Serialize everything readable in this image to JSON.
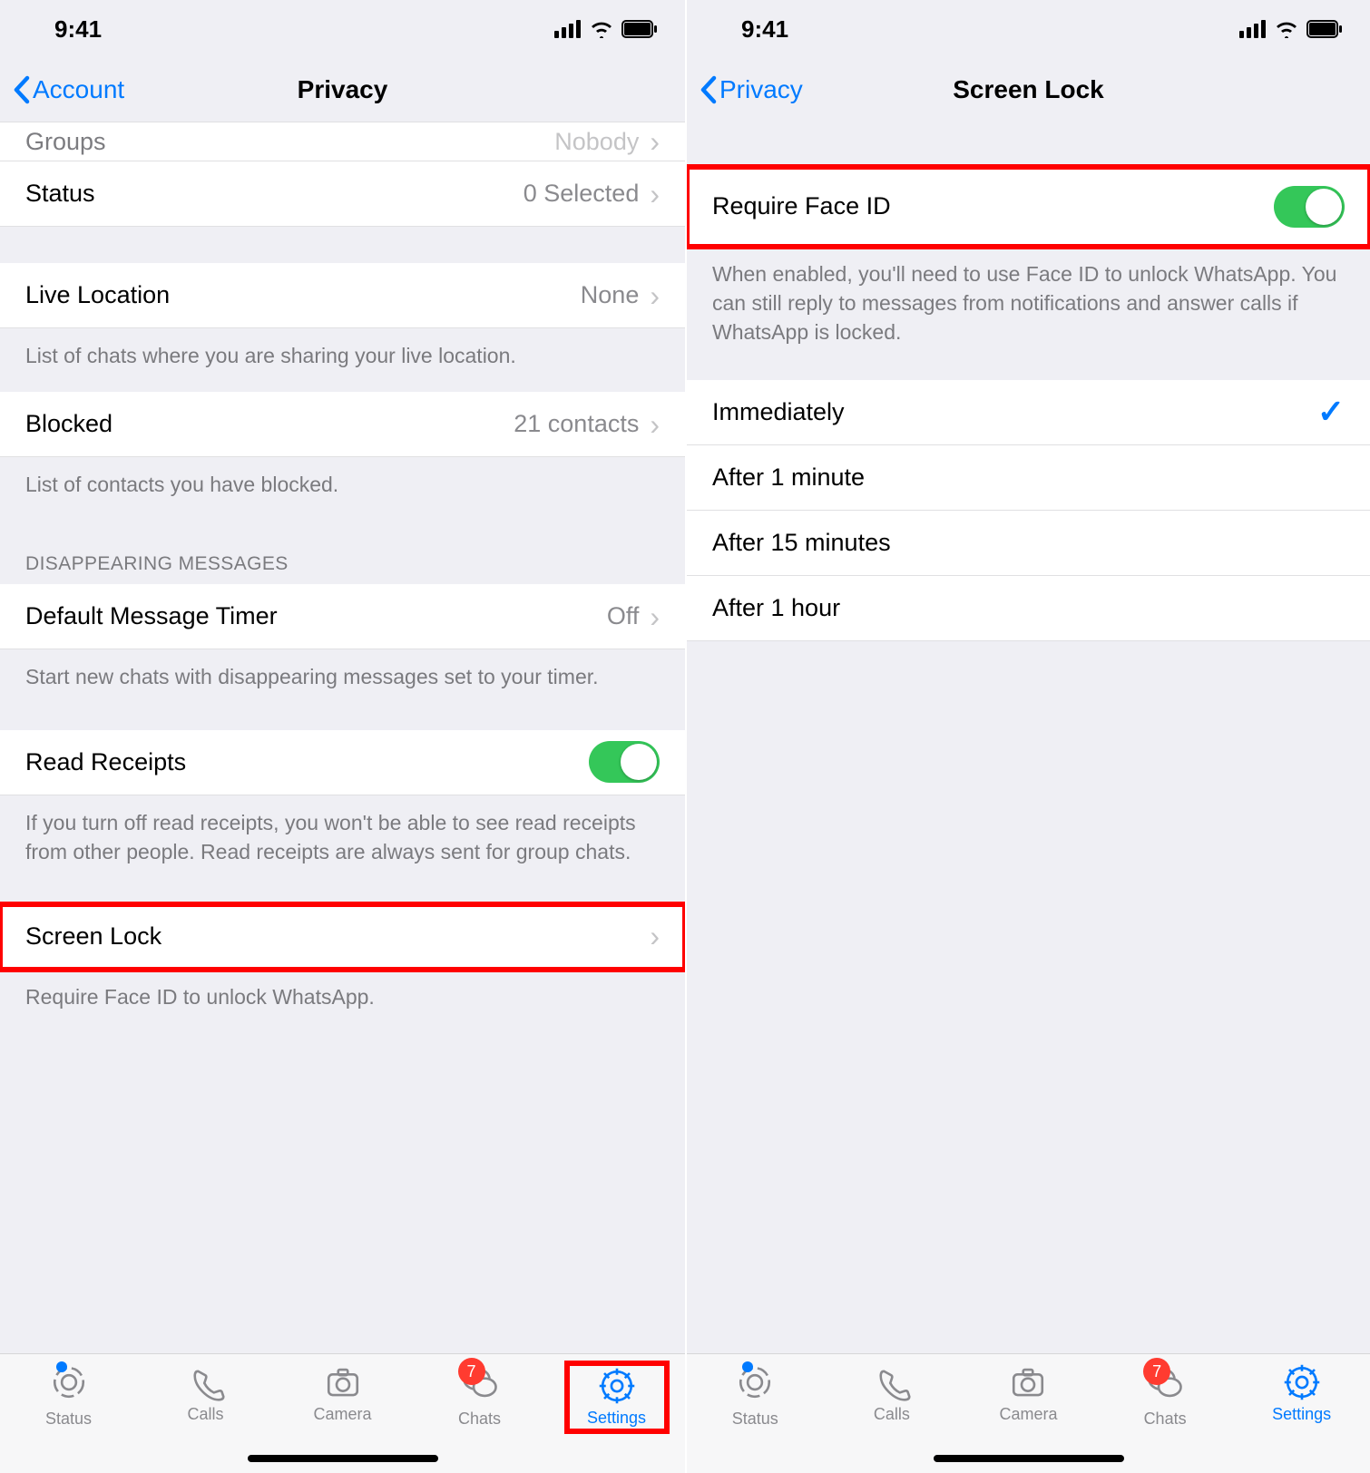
{
  "left": {
    "status_time": "9:41",
    "back_label": "Account",
    "title": "Privacy",
    "rows": {
      "groups": {
        "label": "Groups",
        "value": "Nobody"
      },
      "status": {
        "label": "Status",
        "value": "0 Selected"
      },
      "live_location": {
        "label": "Live Location",
        "value": "None"
      },
      "blocked": {
        "label": "Blocked",
        "value": "21 contacts"
      },
      "default_timer": {
        "label": "Default Message Timer",
        "value": "Off"
      },
      "read_receipts": {
        "label": "Read Receipts"
      },
      "screen_lock": {
        "label": "Screen Lock"
      }
    },
    "footers": {
      "live_location": "List of chats where you are sharing your live location.",
      "blocked": "List of contacts you have blocked.",
      "timer": "Start new chats with disappearing messages set to your timer.",
      "read_receipts": "If you turn off read receipts, you won't be able to see read receipts from other people. Read receipts are always sent for group chats.",
      "screen_lock": "Require Face ID to unlock WhatsApp."
    },
    "section_header": "Disappearing Messages"
  },
  "right": {
    "status_time": "9:41",
    "back_label": "Privacy",
    "title": "Screen Lock",
    "toggle_row": {
      "label": "Require Face ID"
    },
    "toggle_footer": "When enabled, you'll need to use Face ID to unlock WhatsApp. You can still reply to messages from notifications and answer calls if WhatsApp is locked.",
    "options": [
      {
        "label": "Immediately",
        "selected": true
      },
      {
        "label": "After 1 minute",
        "selected": false
      },
      {
        "label": "After 15 minutes",
        "selected": false
      },
      {
        "label": "After 1 hour",
        "selected": false
      }
    ]
  },
  "tabbar": {
    "items": [
      {
        "label": "Status",
        "icon": "status"
      },
      {
        "label": "Calls",
        "icon": "calls"
      },
      {
        "label": "Camera",
        "icon": "camera"
      },
      {
        "label": "Chats",
        "icon": "chats",
        "badge": "7"
      },
      {
        "label": "Settings",
        "icon": "settings",
        "active": true
      }
    ]
  }
}
